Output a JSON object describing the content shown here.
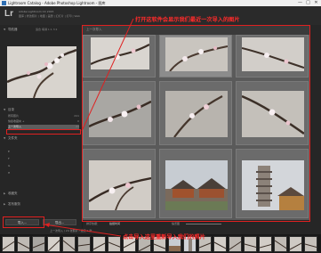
{
  "window": {
    "title": "Lightroom Catalog - Adobe Photoshop Lightroom - 图库",
    "controls": [
      "—",
      "□",
      "✕"
    ]
  },
  "identity": {
    "logo": "Lr",
    "catalog_name": "Adobe Lightroom CC 2015",
    "catalog_sub": "图库 | 修改照片 | 地图 | 画册 | 幻灯片 | 打印 | Web"
  },
  "left_panel": {
    "navigator": {
      "label": "导航器",
      "zoom": "适合  填满  1:1  3:1"
    },
    "catalog": {
      "label": "目录",
      "items": [
        {
          "label": "所有照片",
          "count": "241"
        },
        {
          "label": "快捷收藏夹 +",
          "count": "0"
        },
        {
          "label": "上一次导入",
          "count": "24",
          "selected": true
        }
      ]
    },
    "folders": {
      "label": "文件夹",
      "items": [
        {
          "label": "E",
          "count": ""
        },
        {
          "label": "F",
          "count": ""
        },
        {
          "label": "G",
          "count": ""
        },
        {
          "label": "H",
          "count": ""
        }
      ]
    },
    "collections": {
      "label": "收藏夹"
    },
    "publish": {
      "label": "发布服务"
    },
    "buttons": {
      "import": "导入...",
      "export": "导出..."
    }
  },
  "grid": {
    "header": "上一次导入"
  },
  "toolbar": {
    "sort_label": "排序依据：",
    "sort_value": "拍摄时间",
    "thumbs_label": "缩览图"
  },
  "filmstrip": {
    "source": "上一次导入 / 24 张照片 / 选定 1 张"
  },
  "annotations": {
    "top": "打开这软件会显示我们最近一次导入的图片",
    "bottom": "点击导入这里重新导入我们的照片"
  },
  "colors": {
    "annotation": "#e02020",
    "selected": "#5d5d5d",
    "accent": "#2f6fb3"
  }
}
